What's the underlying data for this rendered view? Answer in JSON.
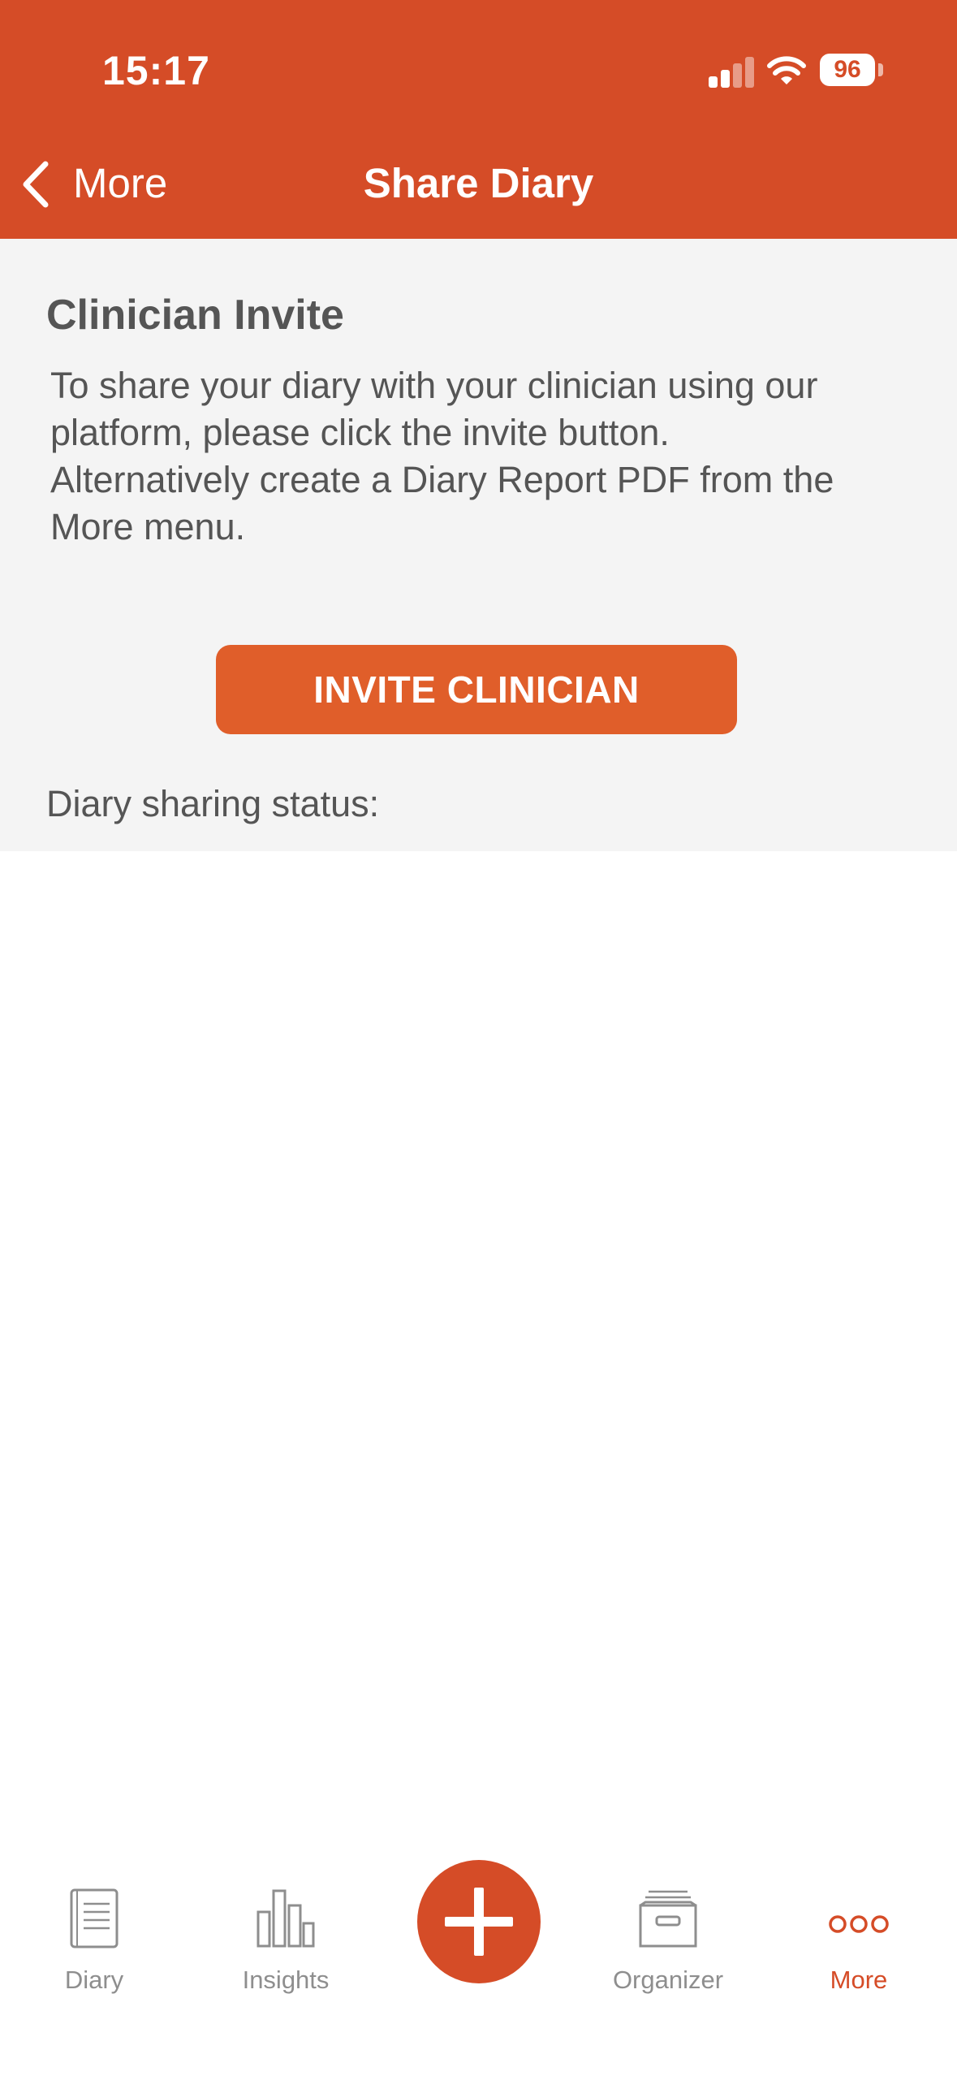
{
  "status_bar": {
    "time": "15:17",
    "battery": "96"
  },
  "nav": {
    "back_label": "More",
    "title": "Share Diary"
  },
  "content": {
    "section_title": "Clinician Invite",
    "paragraph1": "To share your diary with your clinician using our platform, please click the invite button.",
    "paragraph2": "Alternatively create a Diary Report PDF from the More menu.",
    "invite_button": "INVITE CLINICIAN",
    "sharing_status_label": "Diary sharing status:"
  },
  "tab_bar": {
    "tabs": [
      {
        "label": "Diary",
        "icon": "diary-icon"
      },
      {
        "label": "Insights",
        "icon": "insights-icon"
      },
      {
        "label": "Organizer",
        "icon": "organizer-icon"
      },
      {
        "label": "More",
        "icon": "more-icon"
      }
    ],
    "active": "More"
  },
  "colors": {
    "brand": "#d54c27",
    "button": "#e05e2a",
    "text": "#555555",
    "panel": "#f4f4f4"
  }
}
